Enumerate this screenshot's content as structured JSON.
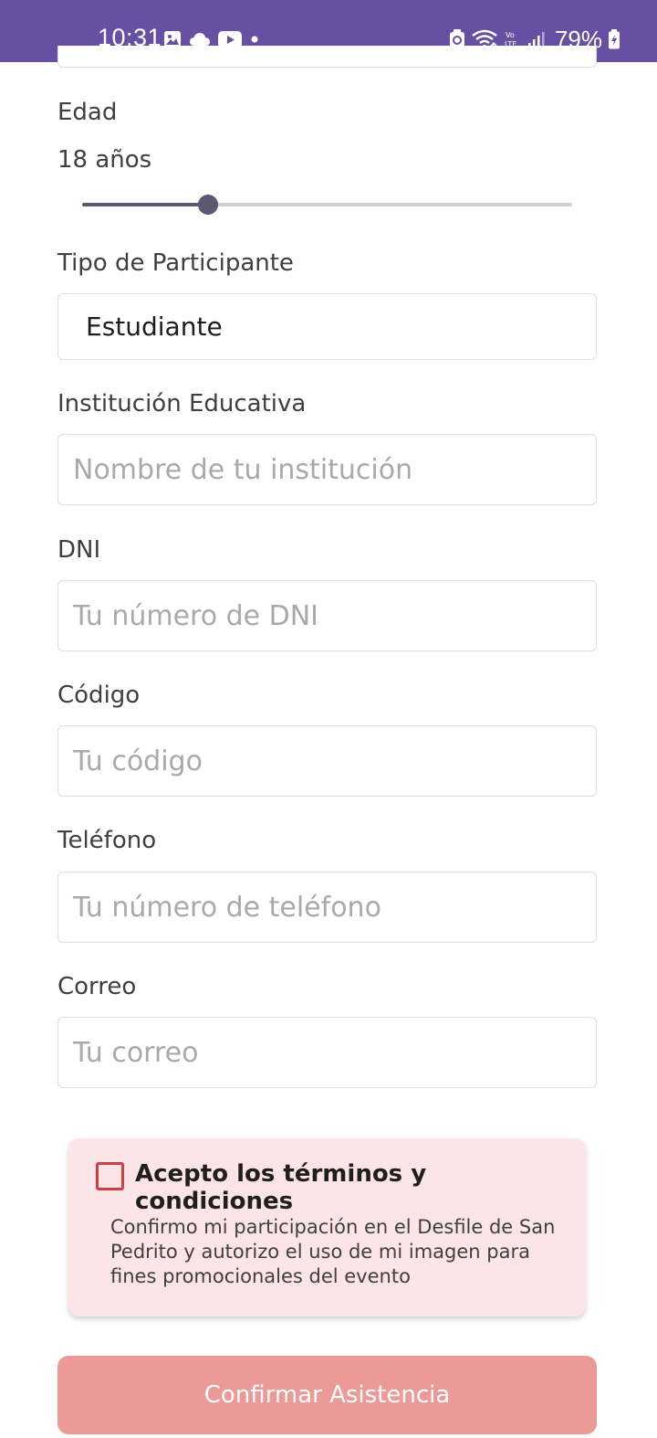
{
  "status_bar": {
    "time": "10:31",
    "battery": "79%",
    "bg_color": "#6750a4",
    "icons_left": [
      "gallery-icon",
      "cloud-icon",
      "youtube-icon",
      "dot-icon"
    ],
    "icons_right": [
      "sync-icon",
      "wifi-icon",
      "volte-icon",
      "signal-icon",
      "battery-charging-icon"
    ]
  },
  "form": {
    "age": {
      "label": "Edad",
      "value_text": "18 años",
      "slider_fraction": 0.257
    },
    "participant_type": {
      "label": "Tipo de Participante",
      "selected": "Estudiante"
    },
    "institution": {
      "label": "Institución Educativa",
      "placeholder": "Nombre de tu institución"
    },
    "dni": {
      "label": "DNI",
      "placeholder": "Tu número de DNI"
    },
    "code": {
      "label": "Código",
      "placeholder": "Tu código"
    },
    "phone": {
      "label": "Teléfono",
      "placeholder": "Tu número de teléfono"
    },
    "email": {
      "label": "Correo",
      "placeholder": "Tu correo"
    }
  },
  "terms": {
    "checked": false,
    "title": "Acepto los términos y condiciones",
    "description": "Confirmo mi participación en el Desfile de San Pedrito y autorizo el uso de mi imagen para fines promocionales del evento",
    "card_color": "#fde4e6",
    "checkbox_color": "#c9404a"
  },
  "confirm_button": {
    "label": "Confirmar Asistencia",
    "color": "#eb9a98",
    "enabled": false
  }
}
